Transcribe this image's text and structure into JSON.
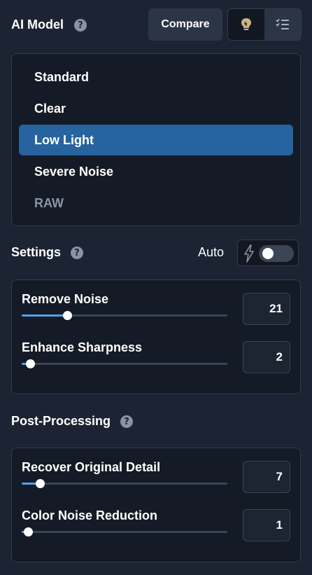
{
  "header": {
    "title": "AI Model",
    "compare_label": "Compare",
    "view_toggle": {
      "icons": [
        "bulb-icon",
        "list-icon"
      ],
      "active": "list-icon"
    }
  },
  "models": {
    "items": [
      {
        "label": "Standard",
        "state": "normal"
      },
      {
        "label": "Clear",
        "state": "normal"
      },
      {
        "label": "Low Light",
        "state": "selected"
      },
      {
        "label": "Severe Noise",
        "state": "normal"
      },
      {
        "label": "RAW",
        "state": "disabled"
      }
    ]
  },
  "settings": {
    "title": "Settings",
    "auto_label": "Auto",
    "auto_enabled": false,
    "sliders": [
      {
        "label": "Remove Noise",
        "value": "21",
        "level": 0.22
      },
      {
        "label": "Enhance Sharpness",
        "value": "2",
        "level": 0.04
      }
    ]
  },
  "post_processing": {
    "title": "Post-Processing",
    "sliders": [
      {
        "label": "Recover Original Detail",
        "value": "7",
        "level": 0.09
      },
      {
        "label": "Color Noise Reduction",
        "value": "1",
        "level": 0.03
      }
    ]
  },
  "colors": {
    "background": "#1c2433",
    "panel": "#141a26",
    "selected": "#27639e",
    "slider_fill": "#4ea3ef"
  }
}
